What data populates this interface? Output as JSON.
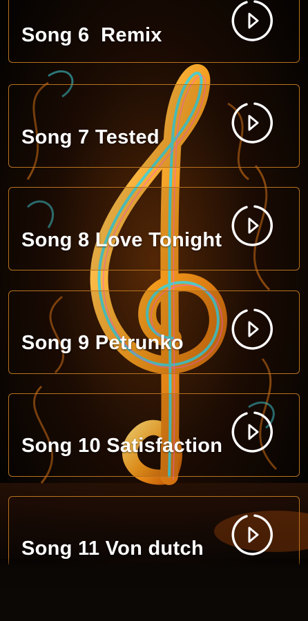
{
  "theme": {
    "card_border": "#b8731e",
    "text": "#ffffff",
    "icon": "#ffffff"
  },
  "background": {
    "icon": "treble-clef-illustration"
  },
  "songs": [
    {
      "title": "Song 6  Remix",
      "icon": "play-circle-icon"
    },
    {
      "title": "Song 7 Tested",
      "icon": "play-circle-icon"
    },
    {
      "title": "Song 8 Love Tonight",
      "icon": "play-circle-icon"
    },
    {
      "title": "Song 9 Petrunko",
      "icon": "play-circle-icon"
    },
    {
      "title": "Song 10 Satisfaction",
      "icon": "play-circle-icon"
    },
    {
      "title": "Song 11 Von dutch",
      "icon": "play-circle-icon"
    }
  ]
}
